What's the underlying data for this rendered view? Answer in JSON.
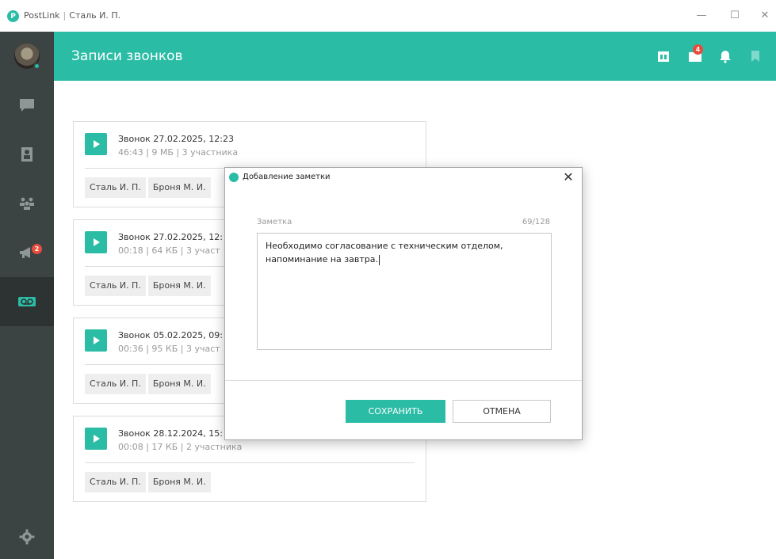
{
  "window": {
    "app_name": "PostLink",
    "separator": "|",
    "user_name": "Сталь И. П.",
    "controls": {
      "minimize": "—",
      "maximize": "☐",
      "close": "✕"
    }
  },
  "sidebar": {
    "items": [
      {
        "icon": "avatar-icon"
      },
      {
        "icon": "chat-icon"
      },
      {
        "icon": "contacts-icon"
      },
      {
        "icon": "groups-icon"
      },
      {
        "icon": "megaphone-icon",
        "badge": "2"
      },
      {
        "icon": "voicemail-icon",
        "active": true
      },
      {
        "icon": "settings-icon"
      }
    ]
  },
  "header": {
    "title": "Записи звонков",
    "notification_badge": "4",
    "icons": [
      "calendar-icon",
      "notifications-folder-icon",
      "bell-icon",
      "bookmark-icon"
    ]
  },
  "calls": [
    {
      "title": "Звонок 27.02.2025, 12:23",
      "meta": "46:43 | 9 МБ | 3 участника",
      "participants": [
        "Сталь И. П.",
        "Броня М. И."
      ]
    },
    {
      "title": "Звонок 27.02.2025, 12:",
      "meta": "00:18 | 64 КБ | 3 участ",
      "participants": [
        "Сталь И. П.",
        "Броня М. И."
      ]
    },
    {
      "title": "Звонок 05.02.2025, 09:",
      "meta": "00:36 | 95 КБ | 3 участ",
      "participants": [
        "Сталь И. П.",
        "Броня М. И."
      ]
    },
    {
      "title": "Звонок 28.12.2024, 15:",
      "meta": "00:08 | 17 КБ | 2 участника",
      "participants": [
        "Сталь И. П.",
        "Броня М. И."
      ]
    }
  ],
  "dialog": {
    "title": "Добавление заметки",
    "close": "✕",
    "label": "Заметка",
    "counter": "69/128",
    "text_line1": "Необходимо согласование с техническим отделом,",
    "text_line2": "напоминание на завтра.",
    "save": "СОХРАНИТЬ",
    "cancel": "ОТМЕНА"
  },
  "colors": {
    "accent": "#2bbca6",
    "sidebar": "#3c4343",
    "badge": "#e74c3c"
  }
}
